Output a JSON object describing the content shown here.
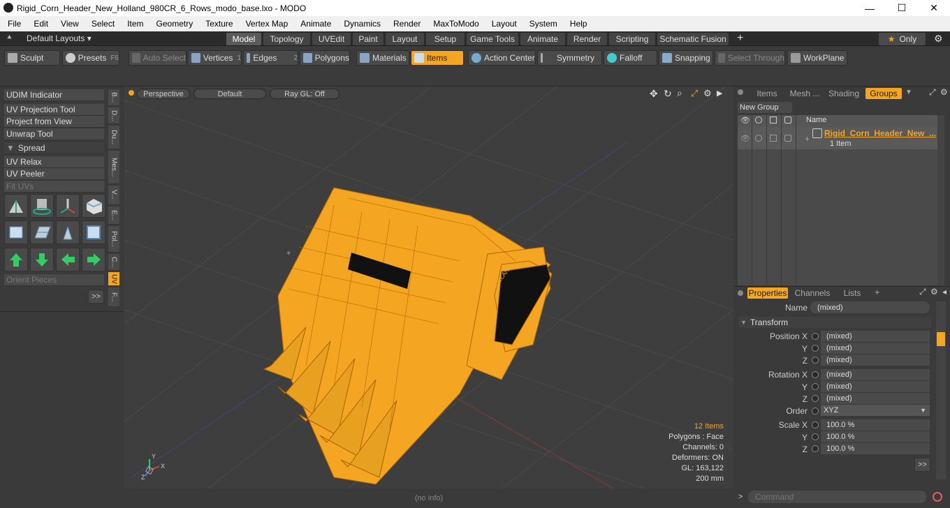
{
  "window": {
    "title": "Rigid_Corn_Header_New_Holland_980CR_6_Rows_modo_base.lxo - MODO"
  },
  "menu": [
    "File",
    "Edit",
    "View",
    "Select",
    "Item",
    "Geometry",
    "Texture",
    "Vertex Map",
    "Animate",
    "Dynamics",
    "Render",
    "MaxToModo",
    "Layout",
    "System",
    "Help"
  ],
  "layouts": {
    "default": "Default Layouts ▾",
    "tabs": [
      "Model",
      "Topology",
      "UVEdit",
      "Paint",
      "Layout",
      "Setup",
      "Game Tools",
      "Animate",
      "Render",
      "Scripting",
      "Schematic Fusion"
    ],
    "only": "Only"
  },
  "toolbar": {
    "sculpt": "Sculpt",
    "presets": "Presets",
    "presets_key": "F6",
    "auto_select": "Auto Select",
    "vertices": "Vertices",
    "vertices_n": "1",
    "edges": "Edges",
    "edges_n": "2",
    "polygons": "Polygons",
    "materials": "Materials",
    "items": "Items",
    "action_center": "Action Center",
    "symmetry": "Symmetry",
    "falloff": "Falloff",
    "snapping": "Snapping",
    "select_through": "Select Through",
    "workplane": "WorkPlane"
  },
  "leftpanel": {
    "tools": [
      "UDIM Indicator",
      "UV Projection Tool",
      "Project from View",
      "Unwrap Tool"
    ],
    "spread": "Spread",
    "tools2": [
      "UV Relax",
      "UV Peeler"
    ],
    "fit_uvs": "Fit UVs",
    "orient_pieces": "Orient Pieces",
    "more": ">>",
    "vtabs": [
      "B...",
      "D...",
      "Du...",
      "Mes...",
      "V...",
      "E...",
      "Pol...",
      "C...",
      "UV",
      "F..."
    ]
  },
  "viewport": {
    "perspective": "Perspective",
    "default": "Default",
    "raygl": "Ray GL: Off",
    "stats": {
      "items": "12 Items",
      "polygons": "Polygons : Face",
      "channels": "Channels: 0",
      "deformers": "Deformers: ON",
      "gl": "GL: 163,122",
      "scale": "200 mm"
    },
    "axis_x": "X",
    "axis_y": "Y",
    "axis_z": "Z"
  },
  "status": {
    "info": "(no info)"
  },
  "groups": {
    "tabs": [
      "Items",
      "Mesh ...",
      "Shading",
      "Groups"
    ],
    "new_group": "New Group",
    "col_name": "Name",
    "item_name": "Rigid_Corn_Header_New_...",
    "item_count": "1 Item"
  },
  "properties": {
    "tabs": [
      "Properties",
      "Channels",
      "Lists"
    ],
    "name_label": "Name",
    "name_value": "(mixed)",
    "transform": "Transform",
    "position_label": "Position X",
    "rotation_label": "Rotation X",
    "order_label": "Order",
    "order_value": "XYZ",
    "scale_label": "Scale X",
    "y": "Y",
    "z": "Z",
    "mixed": "(mixed)",
    "scale_val": "100.0 %",
    "more": ">>"
  },
  "command": {
    "placeholder": "Command"
  },
  "colors": {
    "accent": "#f4a522",
    "bg": "#3a3a3a"
  }
}
